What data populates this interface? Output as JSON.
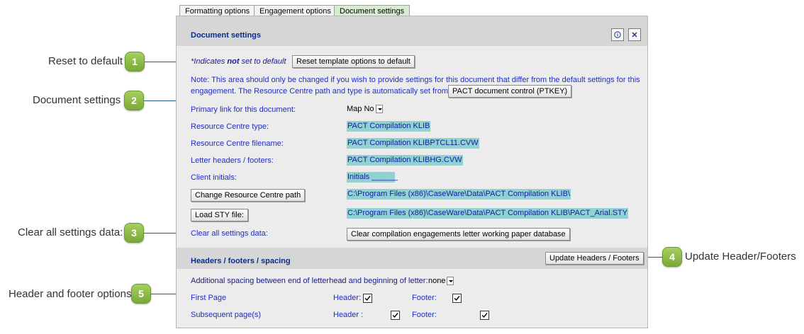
{
  "tabs": [
    {
      "label": "Formatting options"
    },
    {
      "label": "Engagement options"
    },
    {
      "label": "Document settings",
      "active": true
    }
  ],
  "callouts": [
    {
      "number": "1",
      "label": "Reset to default"
    },
    {
      "number": "2",
      "label": "Document settings"
    },
    {
      "number": "3",
      "label": "Clear all settings data:"
    },
    {
      "number": "4",
      "label": "Update Header/Footers"
    },
    {
      "number": "5",
      "label": "Header and footer options"
    }
  ],
  "document_settings": {
    "title": "Document settings",
    "info_icon": "info-icon",
    "close_icon": "close-icon",
    "indicates_prefix": "*Indicates ",
    "indicates_bold": "not",
    "indicates_suffix": " set to default",
    "reset_button": "Reset template options to default",
    "note_line1": "Note: This area should only be changed if you wish to provide settings for this document that differ from the default settings for this",
    "note_line2": "engagement.  The Resource Centre path and type is automatically set from",
    "pact_button": "PACT document control (PTKEY)",
    "note_end": ".",
    "primary_link_label": "Primary link for this document:",
    "primary_link_value": "Map No",
    "rc_type_label": "Resource Centre type:",
    "rc_type_value": "PACT Compilation KLIB",
    "rc_filename_label": "Resource Centre filename:",
    "rc_filename_value": "PACT Compilation KLIBPTCL11.CVW",
    "letter_headers_label": "Letter headers / footers:",
    "letter_headers_value": "PACT Compilation KLIBHG.CVW",
    "client_initials_label": "Client initials:",
    "client_initials_value": "Initials ______",
    "change_rc_button": "Change Resource Centre path",
    "rc_path_value": "C:\\Program Files (x86)\\CaseWare\\Data\\PACT Compilation KLIB\\",
    "load_sty_button": "Load STY file:",
    "sty_path_value": "C:\\Program Files (x86)\\CaseWare\\Data\\PACT Compilation KLIB\\PACT_Arial.STY",
    "clear_label": "Clear all settings data:",
    "clear_button": "Clear compilation engagements letter working paper database"
  },
  "headers_footers": {
    "title": "Headers / footers / spacing",
    "update_button": "Update Headers / Footers",
    "spacing_label": "Additional spacing between end of letterhead and beginning of letter:",
    "spacing_value": "none",
    "first_page_label": "First Page",
    "subsequent_label": "Subsequent page(s)",
    "header_label_first": "Header:",
    "footer_label_first": "Footer:",
    "header_label_sub": "Header :",
    "footer_label_sub": "Footer:",
    "first_header_checked": true,
    "first_footer_checked": true,
    "sub_header_checked": true,
    "sub_footer_checked": true
  }
}
